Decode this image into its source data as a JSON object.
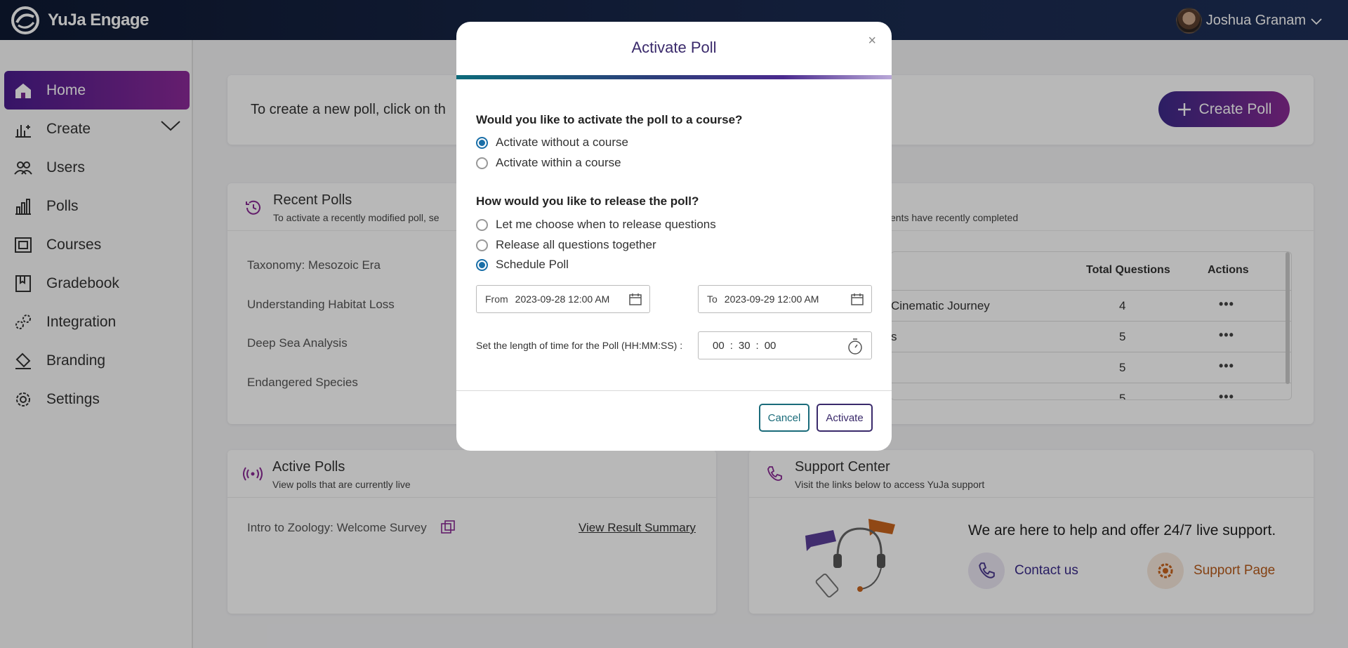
{
  "app": {
    "name": "YuJa Engage"
  },
  "user": {
    "name": "Joshua Granam"
  },
  "sidebar": {
    "items": [
      {
        "label": "Home"
      },
      {
        "label": "Create"
      },
      {
        "label": "Users"
      },
      {
        "label": "Polls"
      },
      {
        "label": "Courses"
      },
      {
        "label": "Gradebook"
      },
      {
        "label": "Integration"
      },
      {
        "label": "Branding"
      },
      {
        "label": "Settings"
      }
    ]
  },
  "banner": {
    "text": "To create a new poll, click on th",
    "create_label": "Create Poll"
  },
  "recent_polls": {
    "title": "Recent Polls",
    "subtitle": "To activate a recently modified poll, se",
    "items": [
      "Taxonomy: Mesozoic Era",
      "Understanding Habitat Loss",
      "Deep Sea Analysis",
      "Endangered Species"
    ]
  },
  "completed": {
    "subtitle": "ents have recently completed",
    "headers": {
      "total": "Total Questions",
      "actions": "Actions"
    },
    "rows": [
      {
        "name": "Cinematic Journey",
        "total": "4"
      },
      {
        "name": "s",
        "total": "5"
      },
      {
        "name": "",
        "total": "5"
      },
      {
        "name": "",
        "total": "5"
      }
    ],
    "more_label": "•••"
  },
  "active_polls": {
    "title": "Active Polls",
    "subtitle": "View polls that are currently live",
    "item": "Intro to Zoology: Welcome Survey",
    "link": "View Result Summary"
  },
  "support": {
    "title": "Support Center",
    "subtitle": "Visit the links below to access YuJa support",
    "message": "We are here to help and offer 24/7 live support.",
    "contact": "Contact us",
    "page": "Support Page"
  },
  "modal": {
    "title": "Activate Poll",
    "close": "×",
    "q1": "Would you like to activate the poll to a course?",
    "q1_options": [
      "Activate without a course",
      "Activate within a course"
    ],
    "q1_selected": 0,
    "q2": "How would you like to release the poll?",
    "q2_options": [
      "Let me choose when to release questions",
      "Release all questions together",
      "Schedule Poll"
    ],
    "q2_selected": 2,
    "from_label": "From",
    "from_value": "2023-09-28 12:00 AM",
    "to_label": "To",
    "to_value": "2023-09-29 12:00 AM",
    "length_label": "Set the length of time for the Poll (HH:MM:SS) :",
    "hh": "00",
    "mm": "30",
    "ss": "00",
    "cancel": "Cancel",
    "activate": "Activate"
  },
  "colors": {
    "accent": "#4b1d8e",
    "radio": "#1a6fa8",
    "support_orange": "#c8641e"
  }
}
